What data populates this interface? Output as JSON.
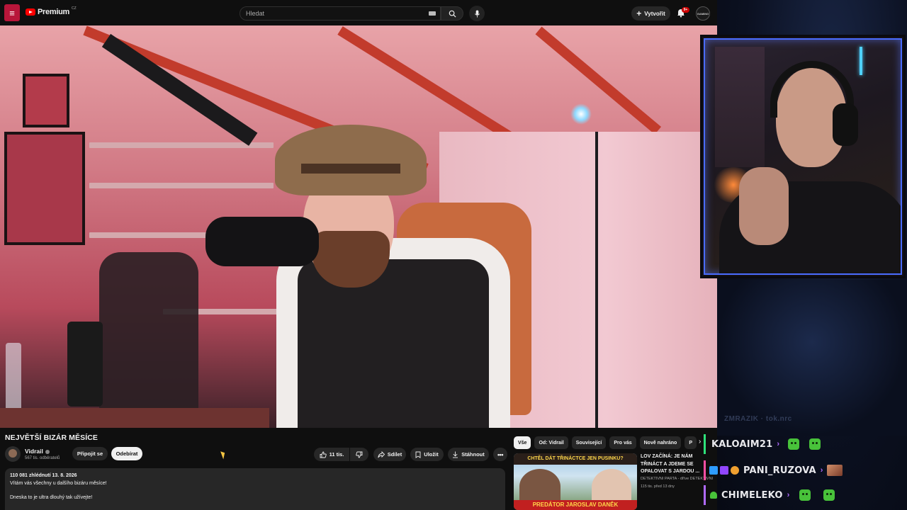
{
  "youtube": {
    "logo_text": "Premium",
    "country_code": "CZ",
    "search": {
      "placeholder": "Hledat"
    },
    "create_label": "Vytvořit",
    "notifications_badge": "9+",
    "avatar_text": "GAMING",
    "video": {
      "title": "NEJVĚTŠÍ BIZÁR MĚSÍCE",
      "channel": "Vidrail",
      "subscribers": "567 tis. odběratelů",
      "join_label": "Připojit se",
      "subscribe_label": "Odebírat",
      "likes": "11 tis.",
      "share_label": "Sdílet",
      "save_label": "Uložit",
      "download_label": "Stáhnout",
      "description": {
        "meta": "110 081 zhlédnutí  13. 8. 2026",
        "line1": "Vítám vás všechny u dalšího bizáru měsíce!",
        "line2": "Dneska to je ultra dlouhý tak užívejte!"
      }
    },
    "chips": [
      {
        "label": "Vše",
        "active": true
      },
      {
        "label": "Od: Vidrail"
      },
      {
        "label": "Související"
      },
      {
        "label": "Pro vás"
      },
      {
        "label": "Nově nahráno"
      },
      {
        "label": "P"
      }
    ],
    "recommendation": {
      "thumb_top": "CHTĚL DÁT TŘINÁCTCE JEN PUSINKU?",
      "thumb_bottom": "PREDÁTOR JAROSLAV DANĚK",
      "title": "LOV ZAČÍNÁ: JE NÁM TŘINÁCT A JDEME SE OPALOVAT S JARDOU ...",
      "channel": "DETEKTIVNÍ PARTA - dříve DETEKTIVNÍ PARTA",
      "meta": "115 tis.  před 13 dny"
    }
  },
  "stream_overlay": {
    "watermark": "ZMRAZIK · tok.nrc",
    "accent_color": "#4a6cff",
    "chat": [
      {
        "name": "KALOAIM21",
        "emotes": [
          "pepe-emote",
          "pepe-emote"
        ]
      },
      {
        "name": "PANI_RUZOVA",
        "emotes": [
          "image-emote"
        ]
      },
      {
        "name": "CHIMELEKO",
        "emotes": [
          "pepe-emote",
          "pepe-emote"
        ]
      }
    ]
  }
}
